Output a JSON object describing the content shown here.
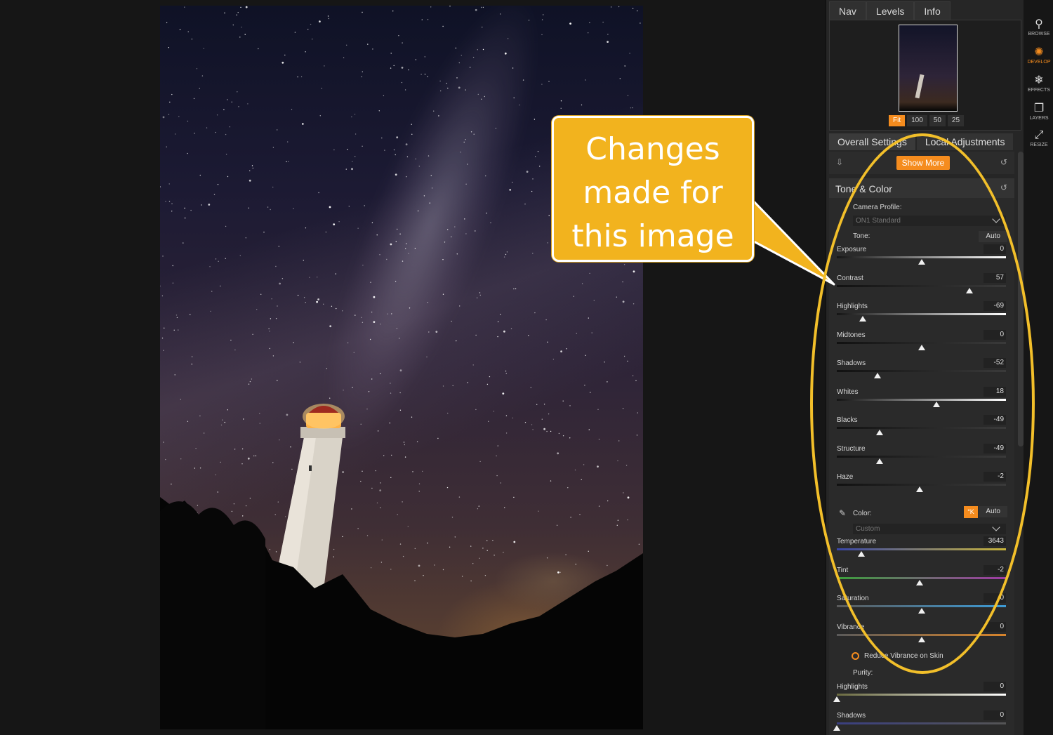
{
  "nav_tabs": [
    "Nav",
    "Levels",
    "Info"
  ],
  "zoom_options": [
    "Fit",
    "100",
    "50",
    "25"
  ],
  "zoom_active": "Fit",
  "settings_tabs": [
    "Overall Settings",
    "Local Adjustments"
  ],
  "show_more_label": "Show More",
  "section_title": "Tone & Color",
  "camera_profile_label": "Camera Profile:",
  "camera_profile_value": "ON1 Standard",
  "tone_label": "Tone:",
  "tone_auto_label": "Auto",
  "sliders": [
    {
      "label": "Exposure",
      "value": "0",
      "position": 0.5
    },
    {
      "label": "Contrast",
      "value": "57",
      "position": 0.785
    },
    {
      "label": "Highlights",
      "value": "-69",
      "position": 0.155
    },
    {
      "label": "Midtones",
      "value": "0",
      "position": 0.5
    },
    {
      "label": "Shadows",
      "value": "-52",
      "position": 0.24
    },
    {
      "label": "Whites",
      "value": "18",
      "position": 0.59
    },
    {
      "label": "Blacks",
      "value": "-49",
      "position": 0.255
    },
    {
      "label": "Structure",
      "value": "-49",
      "position": 0.255
    },
    {
      "label": "Haze",
      "value": "-2",
      "position": 0.49
    }
  ],
  "color_label": "Color:",
  "color_k_label": "°K",
  "color_auto_label": "Auto",
  "color_preset_value": "Custom",
  "color_sliders": [
    {
      "label": "Temperature",
      "value": "3643",
      "position": 0.145,
      "track": "temp"
    },
    {
      "label": "Tint",
      "value": "-2",
      "position": 0.49,
      "track": "tint"
    },
    {
      "label": "Saturation",
      "value": "0",
      "position": 0.5,
      "track": "sat"
    },
    {
      "label": "Vibrance",
      "value": "0",
      "position": 0.5,
      "track": "vib"
    }
  ],
  "reduce_vibrance_label": "Reduce Vibrance on Skin",
  "purity_label": "Purity:",
  "purity_sliders": [
    {
      "label": "Highlights",
      "value": "0",
      "position": 0.0,
      "track": "purh"
    },
    {
      "label": "Shadows",
      "value": "0",
      "position": 0.0,
      "track": "purs"
    }
  ],
  "modules": [
    {
      "label": "BROWSE",
      "icon": "browse-icon",
      "glyph": "⚲",
      "active": false
    },
    {
      "label": "DEVELOP",
      "icon": "develop-icon",
      "glyph": "✺",
      "active": true
    },
    {
      "label": "EFFECTS",
      "icon": "effects-icon",
      "glyph": "❄",
      "active": false
    },
    {
      "label": "LAYERS",
      "icon": "layers-icon",
      "glyph": "❐",
      "active": false
    },
    {
      "label": "RESIZE",
      "icon": "resize-icon",
      "glyph": "⤢",
      "active": false
    }
  ],
  "callout_text": [
    "Changes",
    "made for",
    "this image"
  ],
  "colors": {
    "accent": "#f58c1e",
    "callout": "#f2b31e",
    "ellipse": "#f2bf2a"
  }
}
